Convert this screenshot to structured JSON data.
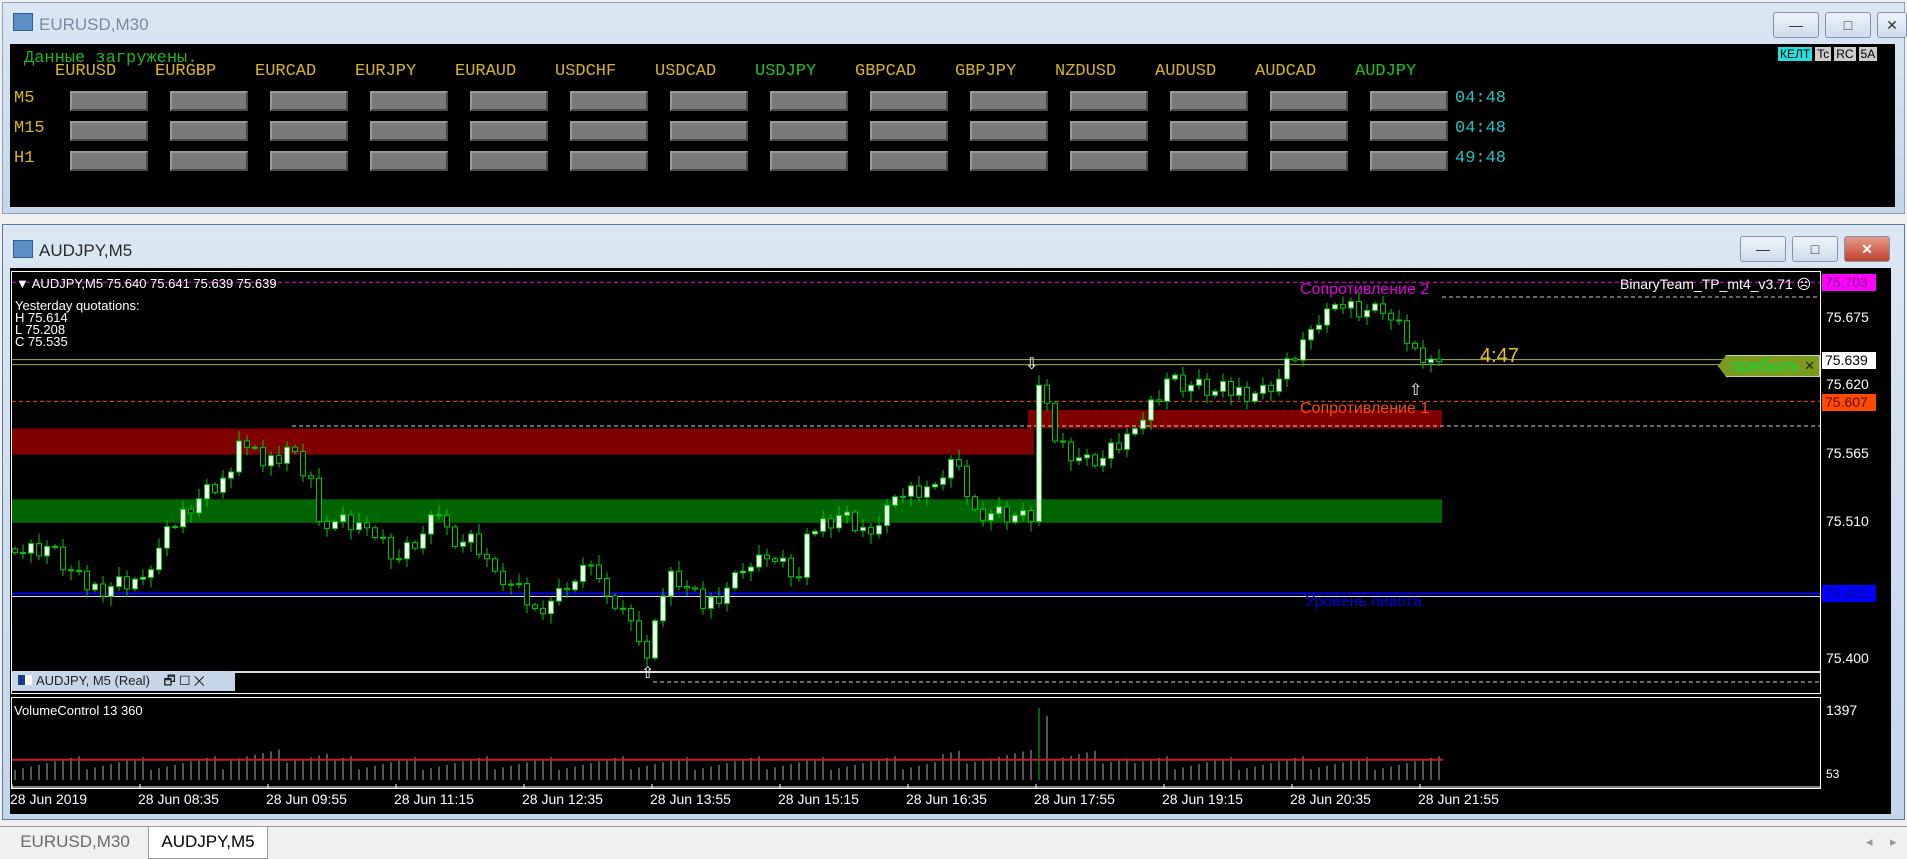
{
  "window1": {
    "title": "EURUSD,M30",
    "status": "Данные загружены.",
    "symbols": [
      {
        "name": "EURUSD",
        "active": false
      },
      {
        "name": "EURGBP",
        "active": false
      },
      {
        "name": "EURCAD",
        "active": false
      },
      {
        "name": "EURJPY",
        "active": false
      },
      {
        "name": "EURAUD",
        "active": false
      },
      {
        "name": "USDCHF",
        "active": false
      },
      {
        "name": "USDCAD",
        "active": false
      },
      {
        "name": "USDJPY",
        "active": true
      },
      {
        "name": "GBPCAD",
        "active": false
      },
      {
        "name": "GBPJPY",
        "active": false
      },
      {
        "name": "NZDUSD",
        "active": false
      },
      {
        "name": "AUDUSD",
        "active": false
      },
      {
        "name": "AUDCAD",
        "active": false
      },
      {
        "name": "AUDJPY",
        "active": true
      }
    ],
    "rows": [
      {
        "label": "M5",
        "time": "04:48"
      },
      {
        "label": "M15",
        "time": "04:48"
      },
      {
        "label": "H1",
        "time": "49:48"
      }
    ],
    "mini_buttons": [
      "КЕЛТ",
      "Tc",
      "RC",
      "5A"
    ],
    "buttons": {
      "minimize": "—",
      "maximize": "□",
      "close": "✕"
    }
  },
  "window2": {
    "title": "AUDJPY,M5",
    "buttons": {
      "minimize": "—",
      "maximize": "□",
      "close": "✕"
    },
    "header": "AUDJPY,M5  75.640 75.641 75.639 75.639",
    "yesterday": {
      "title": "Yesterday quotations:",
      "h": "H 75.614",
      "l": "L 75.208",
      "c": "C 75.535"
    },
    "indicator": "BinaryTeam_TP_mt4_v3.71",
    "indicator_icon": "sad-face-icon",
    "resistance2_label": "Сопротивление 2",
    "resistance1_label": "Сопротивление 1",
    "pivot_label": "Уровень пивота",
    "timer": "4:47",
    "profit_label": "прибыль",
    "profit_close": "×",
    "subwindow_title": "AUDJPY, M5 (Real)",
    "volume_label": "VolumeControl 13 360",
    "colors": {
      "resistance2": "#ff00ff",
      "resistance1": "#ff4a00",
      "pivot": "#0000ff",
      "bull": "#ffffff",
      "wick": "#00c800"
    }
  },
  "tabs": [
    {
      "label": "EURUSD,M30",
      "active": false
    },
    {
      "label": "AUDJPY,M5",
      "active": true
    }
  ],
  "chart_data": {
    "type": "candlestick",
    "symbol": "AUDJPY",
    "timeframe": "M5",
    "ylim": [
      75.372,
      75.711
    ],
    "price_ticks": [
      "75.675",
      "75.620",
      "75.565",
      "75.510",
      "75.400"
    ],
    "price_tags": {
      "resistance2": "75.703",
      "bid": "75.639",
      "resistance1": "75.607",
      "pivot": "75.452"
    },
    "levels": {
      "resistance2": 75.703,
      "bid": 75.639,
      "resistance1": 75.607,
      "pivot": 75.452
    },
    "zones": [
      {
        "type": "resistance",
        "from_bar": 0,
        "to_bar": 127,
        "low": 75.564,
        "high": 75.585
      },
      {
        "type": "resistance",
        "from_bar": 127,
        "to_bar": 178,
        "low": 75.585,
        "high": 75.6
      },
      {
        "type": "support",
        "from_bar": 0,
        "to_bar": 178,
        "low": 75.509,
        "high": 75.528
      }
    ],
    "time_labels": [
      "28 Jun 2019",
      "28 Jun 08:35",
      "28 Jun 09:55",
      "28 Jun 11:15",
      "28 Jun 12:35",
      "28 Jun 13:55",
      "28 Jun 15:15",
      "28 Jun 16:35",
      "28 Jun 17:55",
      "28 Jun 19:15",
      "28 Jun 20:35",
      "28 Jun 21:55"
    ],
    "close_path": [
      [
        0,
        75.485
      ],
      [
        4,
        75.49
      ],
      [
        9,
        75.455
      ],
      [
        16,
        75.465
      ],
      [
        21,
        75.52
      ],
      [
        27,
        75.55
      ],
      [
        28,
        75.575
      ],
      [
        31,
        75.555
      ],
      [
        34,
        75.57
      ],
      [
        37,
        75.545
      ],
      [
        38,
        75.51
      ],
      [
        44,
        75.505
      ],
      [
        48,
        75.48
      ],
      [
        51,
        75.5
      ],
      [
        53,
        75.515
      ],
      [
        55,
        75.49
      ],
      [
        57,
        75.5
      ],
      [
        60,
        75.47
      ],
      [
        65,
        75.44
      ],
      [
        69,
        75.455
      ],
      [
        72,
        75.475
      ],
      [
        74,
        75.45
      ],
      [
        77,
        75.43
      ],
      [
        79,
        75.4
      ],
      [
        80,
        75.43
      ],
      [
        82,
        75.47
      ],
      [
        86,
        75.44
      ],
      [
        91,
        75.47
      ],
      [
        94,
        75.48
      ],
      [
        98,
        75.465
      ],
      [
        99,
        75.5
      ],
      [
        103,
        75.515
      ],
      [
        107,
        75.5
      ],
      [
        110,
        75.53
      ],
      [
        115,
        75.54
      ],
      [
        117,
        75.56
      ],
      [
        120,
        75.52
      ],
      [
        125,
        75.515
      ],
      [
        127,
        75.51
      ],
      [
        128,
        75.62
      ],
      [
        130,
        75.575
      ],
      [
        135,
        75.555
      ],
      [
        140,
        75.585
      ],
      [
        144,
        75.625
      ],
      [
        150,
        75.615
      ],
      [
        157,
        75.615
      ],
      [
        162,
        75.665
      ],
      [
        165,
        75.685
      ],
      [
        171,
        75.678
      ],
      [
        175,
        75.65
      ],
      [
        178,
        75.639
      ]
    ],
    "arrows": [
      {
        "bar": 127,
        "dir": "down"
      },
      {
        "bar": 175,
        "dir": "up"
      },
      {
        "bar": 79,
        "dir": "up"
      }
    ],
    "volume": {
      "max_label": "1397",
      "min_label": "53",
      "range": [
        53,
        1397
      ],
      "spike_bar": 128,
      "ma": 430
    }
  }
}
